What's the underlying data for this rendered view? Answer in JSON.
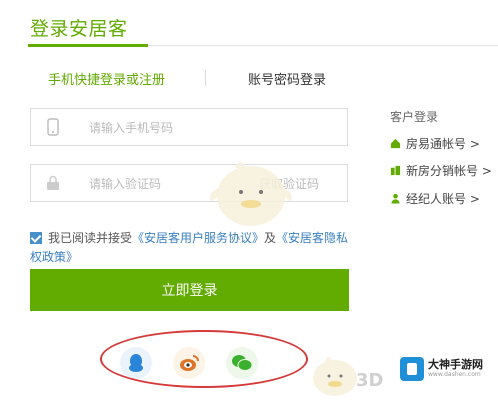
{
  "header": {
    "title": "登录安居客"
  },
  "tabs": {
    "quick": "手机快捷登录或注册",
    "password": "账号密码登录"
  },
  "form": {
    "phone_placeholder": "请输入手机号码",
    "code_placeholder": "请输入验证码",
    "get_code": "获取验证码",
    "agree_prefix": "我已阅读并接受",
    "agreement_link": "《安居客用户服务协议》",
    "agree_and": "及",
    "privacy_link": "《安居客隐私权政策》",
    "agreed": true,
    "login_button": "立即登录"
  },
  "sidebar": {
    "title": "客户登录",
    "items": [
      {
        "label": "房易通帐号 >",
        "icon": "house-icon",
        "color": "#62ab00"
      },
      {
        "label": "新房分销帐号 >",
        "icon": "buildings-icon",
        "color": "#62ab00"
      },
      {
        "label": "经纪人账号 >",
        "icon": "person-icon",
        "color": "#62ab00"
      }
    ]
  },
  "social": [
    {
      "name": "qq",
      "icon": "qq-icon",
      "color": "#2a84d8"
    },
    {
      "name": "weibo",
      "icon": "weibo-icon",
      "color": "#e0752a"
    },
    {
      "name": "wechat",
      "icon": "wechat-icon",
      "color": "#3bb02e"
    }
  ],
  "watermark": {
    "brand": "大神手游网",
    "url": "www.dashen.com",
    "overlay": "3D"
  },
  "colors": {
    "accent": "#62ab00",
    "link": "#3a7fc0",
    "annotation": "#d43a3a"
  }
}
